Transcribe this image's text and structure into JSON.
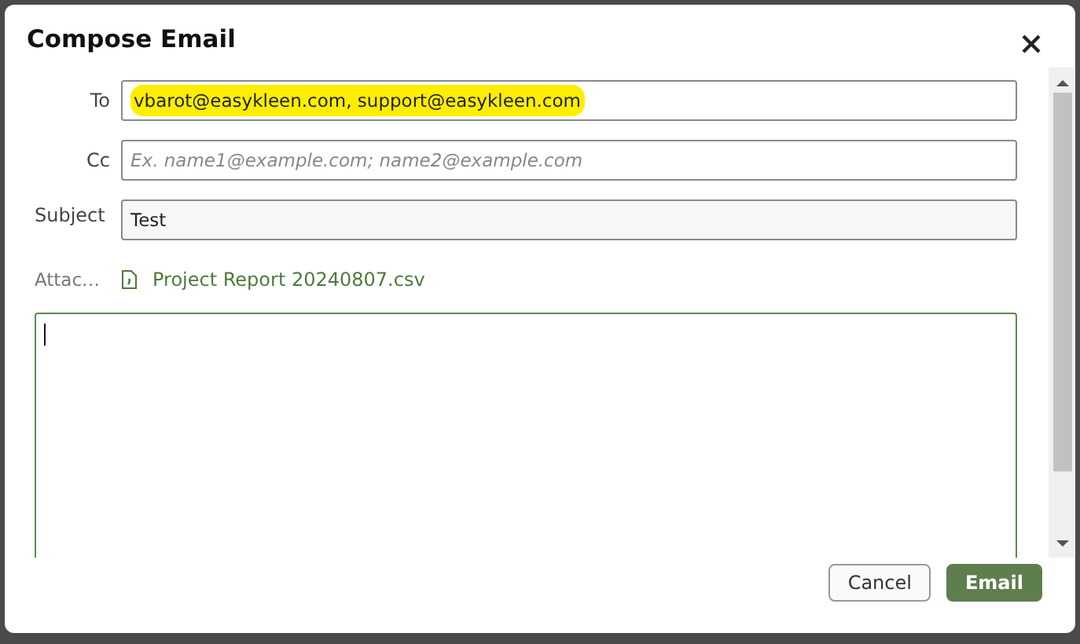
{
  "dialog": {
    "title": "Compose Email"
  },
  "fields": [
    {
      "label": "To",
      "value": "vbarot@easykleen.com, support@easykleen.com",
      "highlighted": true
    },
    {
      "label": "Cc",
      "placeholder": "Ex. name1@example.com; name2@example.com",
      "highlighted": false
    },
    {
      "label": "Subject",
      "value": "Test",
      "highlighted": false
    }
  ],
  "attachment": {
    "label": "Attac…",
    "file": "Project Report 20240807.csv"
  },
  "buttons": [
    {
      "label": "Cancel",
      "kind": "secondary"
    },
    {
      "label": "Email",
      "kind": "primary"
    }
  ]
}
